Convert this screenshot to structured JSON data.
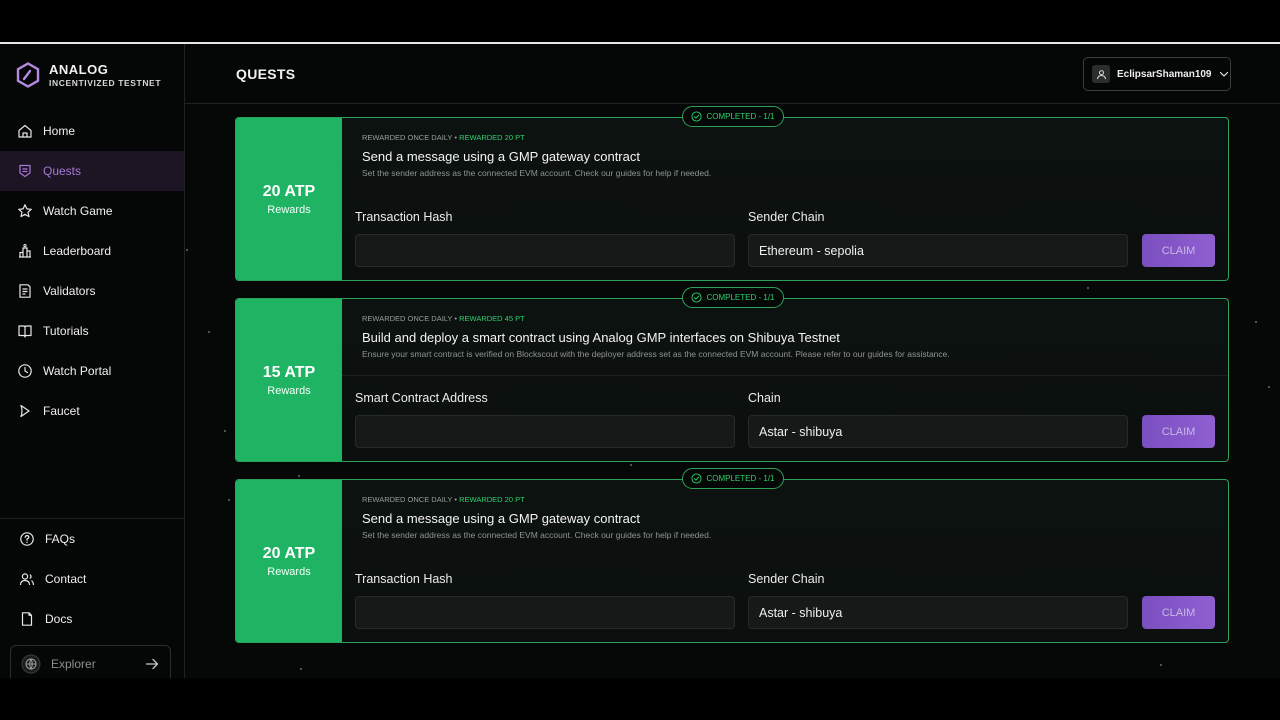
{
  "brand": {
    "name": "ANALOG",
    "subtitle": "INCENTIVIZED TESTNET"
  },
  "sidebar": {
    "items": [
      {
        "label": "Home",
        "icon": "home-icon",
        "active": false
      },
      {
        "label": "Quests",
        "icon": "quests-icon",
        "active": true
      },
      {
        "label": "Watch Game",
        "icon": "star-icon",
        "active": false
      },
      {
        "label": "Leaderboard",
        "icon": "leaderboard-icon",
        "active": false
      },
      {
        "label": "Validators",
        "icon": "validators-icon",
        "active": false
      },
      {
        "label": "Tutorials",
        "icon": "tutorials-icon",
        "active": false
      },
      {
        "label": "Watch Portal",
        "icon": "clock-icon",
        "active": false
      },
      {
        "label": "Faucet",
        "icon": "faucet-icon",
        "active": false
      }
    ],
    "bottom_items": [
      {
        "label": "FAQs",
        "icon": "help-icon"
      },
      {
        "label": "Contact",
        "icon": "contact-icon"
      },
      {
        "label": "Docs",
        "icon": "docs-icon"
      }
    ],
    "explorer": {
      "label": "Explorer",
      "icon": "globe-icon",
      "arrow_icon": "arrow-right-icon"
    }
  },
  "header": {
    "title": "QUESTS",
    "user": {
      "name": "EclipsarShaman109",
      "icon": "user-icon",
      "chevron": "chevron-down-icon"
    }
  },
  "colors": {
    "accent": "#1fb463",
    "purple": "#8f5fd0",
    "border_green": "#2fa05a"
  },
  "quests": [
    {
      "reward_amount": "20 ATP",
      "reward_label": "Rewards",
      "status": "COMPLETED - 1/1",
      "meta_freq": "REWARDED ONCE DAILY",
      "meta_sep": "•",
      "meta_points": "REWARDED 20 PT",
      "title": "Send a message using a GMP gateway contract",
      "description": "Set the sender address as the connected EVM account. Check our guides for help if needed.",
      "field1_label": "Transaction Hash",
      "field1_value": "",
      "field2_label": "Sender Chain",
      "field2_value": "Ethereum - sepolia",
      "claim_label": "CLAIM"
    },
    {
      "reward_amount": "15 ATP",
      "reward_label": "Rewards",
      "status": "COMPLETED - 1/1",
      "meta_freq": "REWARDED ONCE DAILY",
      "meta_sep": "•",
      "meta_points": "REWARDED 45 PT",
      "title": "Build and deploy a smart contract using Analog GMP interfaces on Shibuya Testnet",
      "description": "Ensure your smart contract is verified on Blockscout with the deployer address set as the connected EVM account. Please refer to our guides for assistance.",
      "field1_label": "Smart Contract Address",
      "field1_value": "",
      "field2_label": "Chain",
      "field2_value": "Astar - shibuya",
      "claim_label": "CLAIM"
    },
    {
      "reward_amount": "20 ATP",
      "reward_label": "Rewards",
      "status": "COMPLETED - 1/1",
      "meta_freq": "REWARDED ONCE DAILY",
      "meta_sep": "•",
      "meta_points": "REWARDED 20 PT",
      "title": "Send a message using a GMP gateway contract",
      "description": "Set the sender address as the connected EVM account. Check our guides for help if needed.",
      "field1_label": "Transaction Hash",
      "field1_value": "",
      "field2_label": "Sender Chain",
      "field2_value": "Astar - shibuya",
      "claim_label": "CLAIM"
    }
  ]
}
